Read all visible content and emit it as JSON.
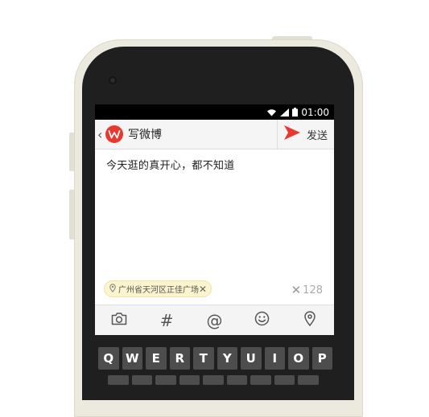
{
  "status_bar": {
    "time": "01:00"
  },
  "title_bar": {
    "back_glyph": "‹",
    "title": "写微博",
    "send_label": "发送"
  },
  "post": {
    "text": "今天逛的真开心，都不知道"
  },
  "location": {
    "name": "广州省天河区正佳广场",
    "clear_glyph": "✕"
  },
  "counter": {
    "clear_glyph": "✕",
    "remaining": "128"
  },
  "toolbar": {
    "hash": "#",
    "mention": "@"
  },
  "keyboard": {
    "row1": [
      "Q",
      "W",
      "E",
      "R",
      "T",
      "Y",
      "U",
      "I",
      "O",
      "P"
    ]
  },
  "colors": {
    "accent": "#e8382f",
    "chip_bg": "#fbf4cc",
    "keyboard_bg": "#1f1f1f",
    "key_bg": "#4d4d4d"
  },
  "icons": [
    "wifi-icon",
    "signal-icon",
    "battery-icon",
    "weibo-logo-icon",
    "send-icon",
    "location-pin-icon",
    "camera-icon",
    "hashtag-icon",
    "mention-icon",
    "emoji-icon",
    "location-icon"
  ]
}
